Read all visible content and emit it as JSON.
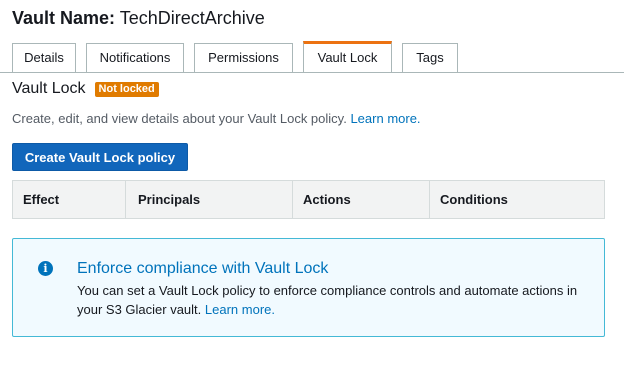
{
  "vault": {
    "name_label": "Vault Name:",
    "name": "TechDirectArchive"
  },
  "tabs": [
    {
      "label": "Details",
      "active": false
    },
    {
      "label": "Notifications",
      "active": false
    },
    {
      "label": "Permissions",
      "active": false
    },
    {
      "label": "Vault Lock",
      "active": true
    },
    {
      "label": "Tags",
      "active": false
    }
  ],
  "section": {
    "title": "Vault Lock",
    "status": "Not locked",
    "description": "Create, edit, and view details about your Vault Lock policy.",
    "description_link": "Learn more."
  },
  "create_button": {
    "label": "Create Vault Lock policy"
  },
  "table": {
    "columns": [
      "Effect",
      "Principals",
      "Actions",
      "Conditions"
    ]
  },
  "info_box": {
    "icon": "info-icon",
    "title": "Enforce compliance with Vault Lock",
    "body": "You can set a Vault Lock policy to enforce compliance controls and automate actions in your S3 Glacier vault.",
    "link": "Learn more."
  },
  "colors": {
    "accent_tab": "#ec7211",
    "badge": "#e07b00",
    "primary_button": "#1166bb",
    "link": "#0073bb",
    "info_border": "#44b9d6",
    "info_background": "#f1faff"
  }
}
